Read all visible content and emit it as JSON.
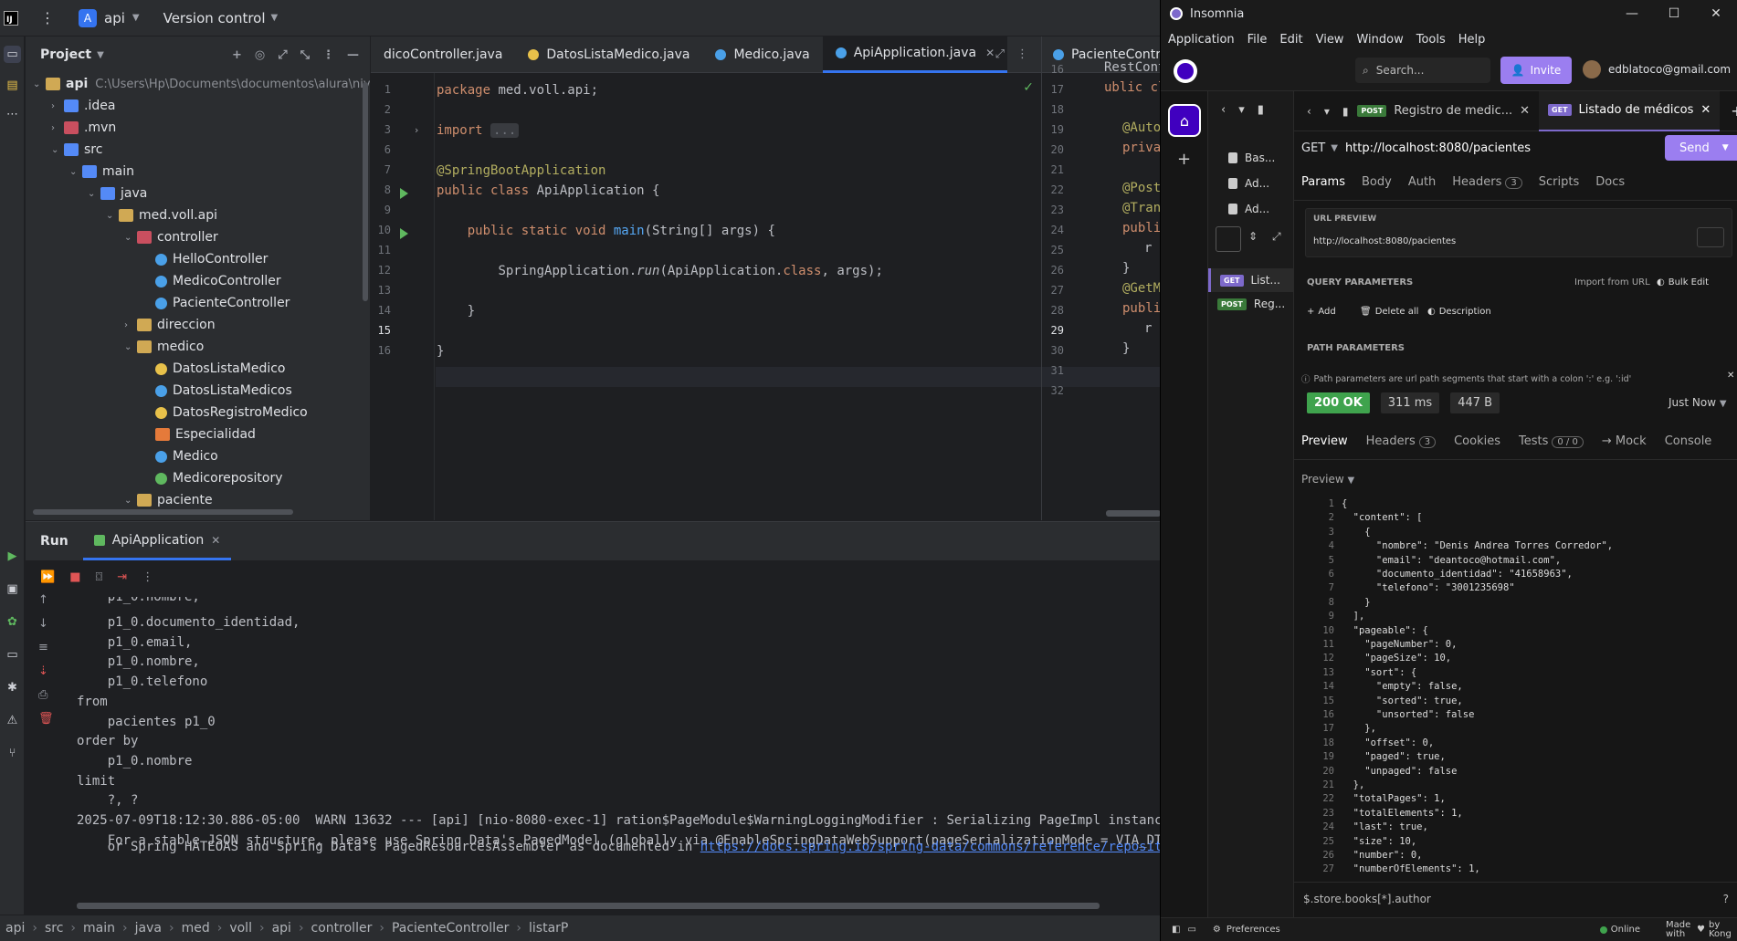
{
  "ide": {
    "project_name": "api",
    "project_badge": "A",
    "version_control": "Version control",
    "project_pane_title": "Project",
    "tree": [
      {
        "label": "api",
        "path": "C:\\Users\\Hp\\Documents\\documentos\\alura\\nive",
        "depth": 0,
        "icon": "folder",
        "open": true
      },
      {
        "label": ".idea",
        "depth": 1,
        "icon": "folder-blue",
        "open": false
      },
      {
        "label": ".mvn",
        "depth": 1,
        "icon": "folder-red",
        "open": false
      },
      {
        "label": "src",
        "depth": 1,
        "icon": "folder-blue",
        "open": true
      },
      {
        "label": "main",
        "depth": 2,
        "icon": "folder-blue",
        "open": true
      },
      {
        "label": "java",
        "depth": 3,
        "icon": "folder-blue",
        "open": true
      },
      {
        "label": "med.voll.api",
        "depth": 4,
        "icon": "folder",
        "open": true
      },
      {
        "label": "controller",
        "depth": 5,
        "icon": "folder-red",
        "open": true
      },
      {
        "label": "HelloController",
        "depth": 6,
        "icon": "class"
      },
      {
        "label": "MedicoController",
        "depth": 6,
        "icon": "class"
      },
      {
        "label": "PacienteController",
        "depth": 6,
        "icon": "class"
      },
      {
        "label": "direccion",
        "depth": 5,
        "icon": "folder",
        "open": false
      },
      {
        "label": "medico",
        "depth": 5,
        "icon": "folder",
        "open": true
      },
      {
        "label": "DatosListaMedico",
        "depth": 6,
        "icon": "record"
      },
      {
        "label": "DatosListaMedicos",
        "depth": 6,
        "icon": "class"
      },
      {
        "label": "DatosRegistroMedico",
        "depth": 6,
        "icon": "record"
      },
      {
        "label": "Especialidad",
        "depth": 6,
        "icon": "enum"
      },
      {
        "label": "Medico",
        "depth": 6,
        "icon": "class"
      },
      {
        "label": "Medicorepository",
        "depth": 6,
        "icon": "iface"
      },
      {
        "label": "paciente",
        "depth": 5,
        "icon": "folder",
        "open": true
      }
    ],
    "editor_tabs": [
      {
        "label": "dicoController.java",
        "icon_color": "#4aa0e8",
        "active": false
      },
      {
        "label": "DatosListaMedico.java",
        "icon_color": "#e8c14a",
        "active": false
      },
      {
        "label": "Medico.java",
        "icon_color": "#4aa0e8",
        "active": false
      },
      {
        "label": "ApiApplication.java",
        "icon_color": "#4aa0e8",
        "active": true
      }
    ],
    "editor2_tab": "PacienteContro",
    "code_line_numbers": [
      "1",
      "2",
      "3",
      "6",
      "7",
      "8",
      "9",
      "10",
      "11",
      "12",
      "13",
      "14",
      "15",
      "16"
    ],
    "code": {
      "package_kw": "package",
      "package_name": " med.voll.api;",
      "import_kw": "import",
      "import_fold": "...",
      "annotation": "@SpringBootApplication",
      "class_decl_kw": "public class",
      "class_decl_rest": " ApiApplication {",
      "main_kw": "public static void",
      "main_fn": "main",
      "main_rest": "(String[] args) {",
      "run_prefix": "SpringApplication.",
      "run_fn": "run",
      "run_mid": "(ApiApplication.",
      "run_class_kw": "class",
      "run_end": ", args);",
      "brace_inner": "}",
      "brace_outer": "}"
    },
    "editor2_line_numbers": [
      "16",
      "17",
      "18",
      "19",
      "20",
      "21",
      "22",
      "23",
      "24",
      "25",
      "26",
      "27",
      "28",
      "29",
      "30",
      "31",
      "32"
    ],
    "editor2_code": [
      "RestCont",
      "ublic cl",
      "",
      "@Auto",
      "priva",
      "",
      "@Post",
      "@Tran",
      "publi",
      "r",
      "}",
      "@GetM",
      "publi",
      "r",
      "}",
      "",
      ""
    ],
    "run": {
      "title": "Run",
      "tab": "ApiApplication",
      "console": [
        "    p1_0.nombre,",
        "    p1_0.documento_identidad,",
        "    p1_0.email,",
        "    p1_0.nombre,",
        "    p1_0.telefono",
        "from",
        "    pacientes p1_0",
        "order by",
        "    p1_0.nombre",
        "limit",
        "    ?, ?",
        "2025-07-09T18:12:30.886-05:00  WARN 13632 --- [api] [nio-8080-exec-1] ration$PageModule$WarningLoggingModifier : Serializing PageImpl instances as-is",
        "    For a stable JSON structure, please use Spring Data's PagedModel (globally via @EnableSpringDataWebSupport(pageSerializationMode = VIA_DTO))"
      ],
      "console_last_prefix": "    or Spring HATEOAS and Spring Data's PagedResourcesAssembler as documented in ",
      "console_link": "https://docs.spring.io/spring-data/commons/reference/repositories/co"
    },
    "breadcrumb": [
      "api",
      "src",
      "main",
      "java",
      "med",
      "voll",
      "api",
      "controller",
      "PacienteController",
      "listarP"
    ]
  },
  "insomnia": {
    "title": "Insomnia",
    "window_controls": [
      "—",
      "☐",
      "✕"
    ],
    "menu": [
      "Application",
      "File",
      "Edit",
      "View",
      "Window",
      "Tools",
      "Help"
    ],
    "search_placeholder": "Search...",
    "invite_label": "Invite",
    "user_email": "edblatoco@gmail.com",
    "sidebar_items": [
      {
        "label": "Bas..."
      },
      {
        "label": "Ad..."
      },
      {
        "label": "Ad..."
      }
    ],
    "sidebar_requests": [
      {
        "method": "GET",
        "label": "List...",
        "active": true
      },
      {
        "method": "POST",
        "label": "Reg...",
        "active": false
      }
    ],
    "request_tabs": [
      {
        "method": "POST",
        "label": "Registro de medic...",
        "active": false
      },
      {
        "method": "GET",
        "label": "Listado de médicos",
        "active": true
      }
    ],
    "request_method": "GET",
    "request_url": "http://localhost:8080/pacientes",
    "send_label": "Send",
    "request_subtabs": [
      {
        "label": "Params",
        "active": true
      },
      {
        "label": "Body",
        "active": false
      },
      {
        "label": "Auth",
        "active": false
      },
      {
        "label": "Headers",
        "count": "3",
        "active": false
      },
      {
        "label": "Scripts",
        "active": false
      },
      {
        "label": "Docs",
        "active": false
      }
    ],
    "url_preview_label": "URL PREVIEW",
    "url_preview_value": "http://localhost:8080/pacientes",
    "query_params_label": "QUERY PARAMETERS",
    "import_from_url": "Import from URL",
    "bulk_edit": "Bulk Edit",
    "add_label": "Add",
    "delete_all_label": "Delete all",
    "description_label": "Description",
    "path_params_label": "PATH PARAMETERS",
    "path_params_hint": "Path parameters are url path segments that start with a colon ':' e.g. ':id'",
    "status": "200 OK",
    "time": "311 ms",
    "size": "447 B",
    "time_ago": "Just Now",
    "response_tabs": [
      {
        "label": "Preview",
        "active": true
      },
      {
        "label": "Headers",
        "count": "3",
        "active": false
      },
      {
        "label": "Cookies",
        "active": false
      },
      {
        "label": "Tests",
        "count": "0 / 0",
        "active": false
      },
      {
        "label": "→ Mock",
        "active": false
      },
      {
        "label": "Console",
        "active": false
      }
    ],
    "preview_dropdown": "Preview",
    "json_lines": [
      "{",
      "  \"content\": [",
      "    {",
      "      \"nombre\": \"Denis Andrea Torres Corredor\",",
      "      \"email\": \"deantoco@hotmail.com\",",
      "      \"documento_identidad\": \"41658963\",",
      "      \"telefono\": \"3001235698\"",
      "    }",
      "  ],",
      "  \"pageable\": {",
      "    \"pageNumber\": 0,",
      "    \"pageSize\": 10,",
      "    \"sort\": {",
      "      \"empty\": false,",
      "      \"sorted\": true,",
      "      \"unsorted\": false",
      "    },",
      "    \"offset\": 0,",
      "    \"paged\": true,",
      "    \"unpaged\": false",
      "  },",
      "  \"totalPages\": 1,",
      "  \"totalElements\": 1,",
      "  \"last\": true,",
      "  \"size\": 10,",
      "  \"number\": 0,",
      "  \"numberOfElements\": 1,"
    ],
    "filter_placeholder": "$.store.books[*].author",
    "preferences": "Preferences",
    "online": "Online",
    "made_with": "Made with",
    "by_kong": "by Kong"
  },
  "colors": {
    "accent": "#3574f0",
    "insomnia_purple": "#9b7ef0",
    "ok_green": "#3fa34d"
  }
}
